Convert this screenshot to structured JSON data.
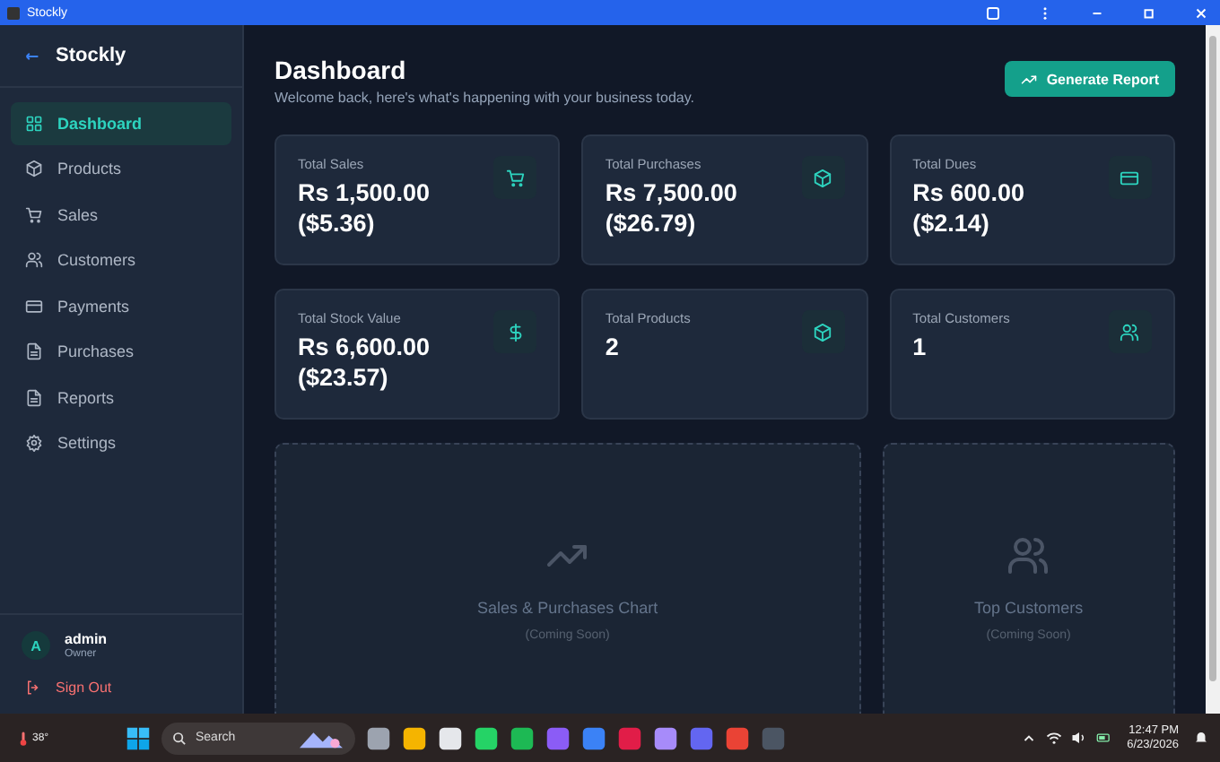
{
  "window": {
    "title": "Stockly"
  },
  "sidebar": {
    "brand": "Stockly",
    "items": [
      {
        "label": "Dashboard",
        "selected": true
      },
      {
        "label": "Products",
        "selected": false
      },
      {
        "label": "Sales",
        "selected": false
      },
      {
        "label": "Customers",
        "selected": false
      },
      {
        "label": "Payments",
        "selected": false
      },
      {
        "label": "Purchases",
        "selected": false
      },
      {
        "label": "Reports",
        "selected": false
      },
      {
        "label": "Settings",
        "selected": false
      }
    ],
    "user": {
      "initial": "A",
      "name": "admin",
      "role": "Owner"
    },
    "sign_out": "Sign Out"
  },
  "header": {
    "title": "Dashboard",
    "subtitle": "Welcome back, here's what's happening with your business today.",
    "button": "Generate Report"
  },
  "stats": [
    {
      "label": "Total Sales",
      "value": "Rs 1,500.00",
      "converted": "($5.36)"
    },
    {
      "label": "Total Purchases",
      "value": "Rs 7,500.00",
      "converted": "($26.79)"
    },
    {
      "label": "Total Dues",
      "value": "Rs 600.00",
      "converted": "($2.14)"
    },
    {
      "label": "Total Stock Value",
      "value": "Rs 6,600.00",
      "converted": "($23.57)"
    },
    {
      "label": "Total Products",
      "value": "2"
    },
    {
      "label": "Total Customers",
      "value": "1"
    }
  ],
  "panels": [
    {
      "title": "Sales & Purchases Chart",
      "note": "(Coming Soon)"
    },
    {
      "title": "Top Customers",
      "note": "(Coming Soon)"
    }
  ],
  "taskbar": {
    "weather": "38°",
    "search": "Search",
    "time": "12:47 PM",
    "date": "6/23/2026"
  }
}
